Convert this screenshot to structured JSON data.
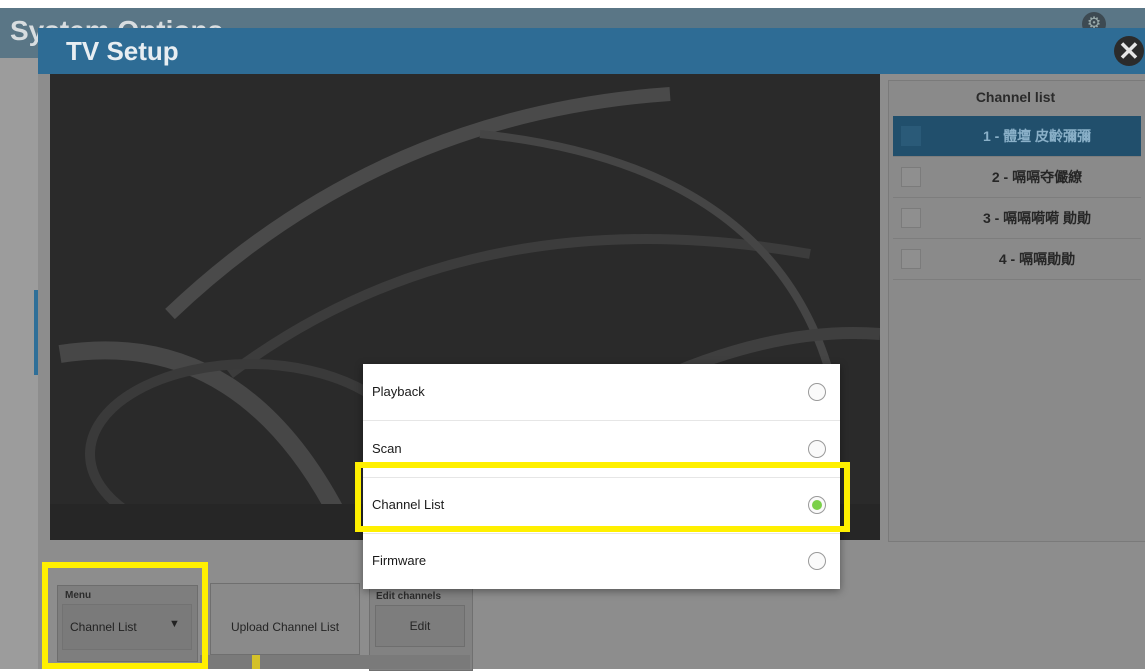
{
  "background_window": {
    "title": "System Options"
  },
  "dialog": {
    "title": "TV Setup",
    "close_label": "✕"
  },
  "channel_panel": {
    "header": "Channel list",
    "channels": [
      {
        "label": "1 - 體壇 皮齡彌彌",
        "active": true
      },
      {
        "label": "2 - 嗝嗝夺儼繚",
        "active": false
      },
      {
        "label": "3 - 嗝嗝嗬嗬 勛勛",
        "active": false
      },
      {
        "label": "4 - 嗝嗝勛勛",
        "active": false
      }
    ]
  },
  "controls": {
    "menu_caption": "Menu",
    "menu_value": "Channel List",
    "upload_label": "Upload Channel List",
    "edit_caption": "Edit channels",
    "edit_label": "Edit"
  },
  "popup": {
    "items": [
      {
        "label": "Playback",
        "selected": false
      },
      {
        "label": "Scan",
        "selected": false
      },
      {
        "label": "Channel List",
        "selected": true
      },
      {
        "label": "Firmware",
        "selected": false
      }
    ]
  },
  "colors": {
    "dialog_header": "#2e6c95",
    "highlight": "#fff000",
    "radio_selected": "#7ad048"
  }
}
